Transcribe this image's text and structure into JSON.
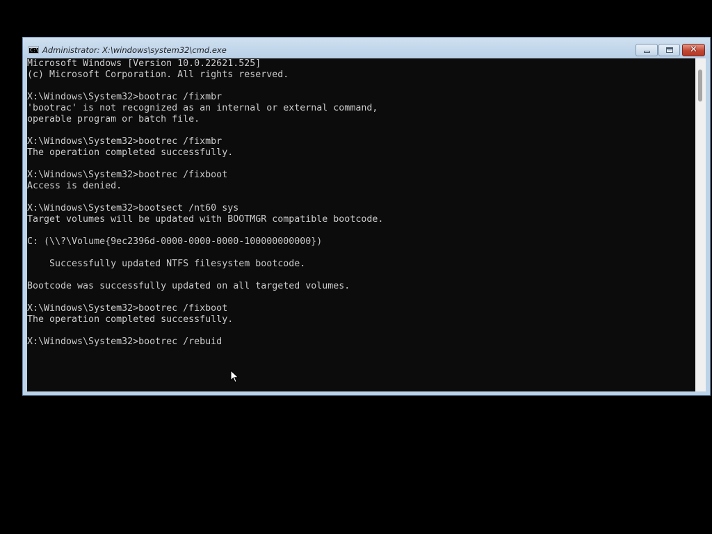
{
  "window": {
    "title": "Administrator: X:\\windows\\system32\\cmd.exe",
    "icon": "cmd-icon",
    "icon_text": "C:\\",
    "controls": {
      "minimize": "minimize-icon",
      "maximize": "maximize-icon",
      "close": "close-icon",
      "close_glyph": "✕"
    }
  },
  "console": {
    "background": "#0c0c0c",
    "foreground": "#cccccc",
    "lines": [
      "Microsoft Windows [Version 10.0.22621.525]",
      "(c) Microsoft Corporation. All rights reserved.",
      "",
      "X:\\Windows\\System32>bootrac /fixmbr",
      "'bootrac' is not recognized as an internal or external command,",
      "operable program or batch file.",
      "",
      "X:\\Windows\\System32>bootrec /fixmbr",
      "The operation completed successfully.",
      "",
      "X:\\Windows\\System32>bootrec /fixboot",
      "Access is denied.",
      "",
      "X:\\Windows\\System32>bootsect /nt60 sys",
      "Target volumes will be updated with BOOTMGR compatible bootcode.",
      "",
      "C: (\\\\?\\Volume{9ec2396d-0000-0000-0000-100000000000})",
      "",
      "    Successfully updated NTFS filesystem bootcode.",
      "",
      "Bootcode was successfully updated on all targeted volumes.",
      "",
      "X:\\Windows\\System32>bootrec /fixboot",
      "The operation completed successfully.",
      "",
      "X:\\Windows\\System32>bootrec /rebuid"
    ]
  }
}
